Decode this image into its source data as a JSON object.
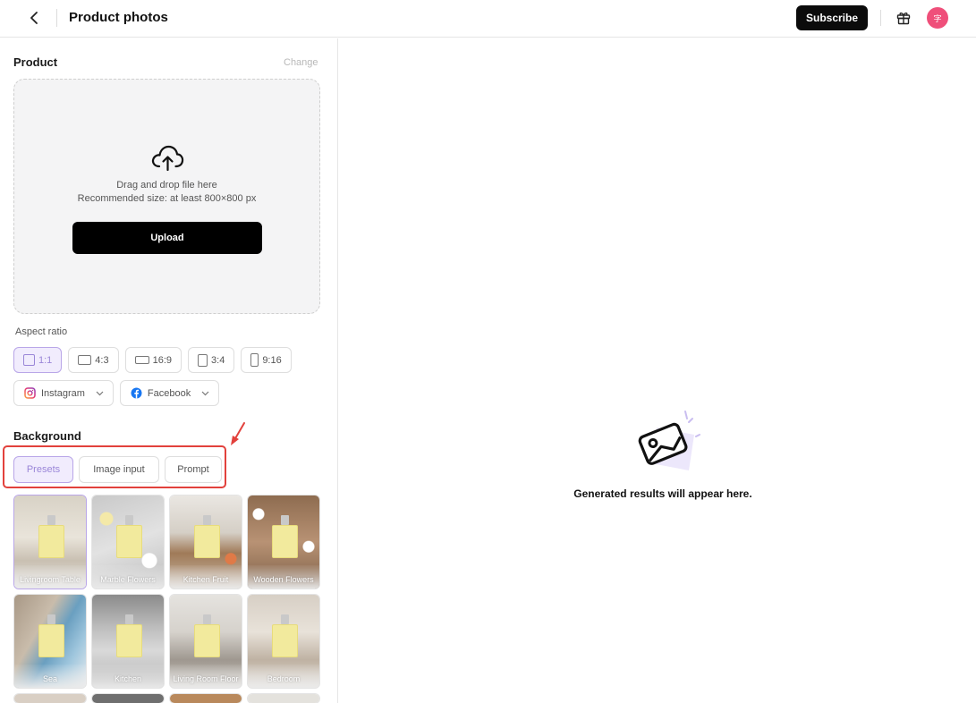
{
  "header": {
    "title": "Product photos",
    "subscribe_label": "Subscribe",
    "avatar_text": "字"
  },
  "product": {
    "title": "Product",
    "change_label": "Change",
    "drop_hint": "Drag and drop file here",
    "size_hint": "Recommended size: at least 800×800 px",
    "upload_label": "Upload"
  },
  "aspect": {
    "label": "Aspect ratio",
    "ratios": [
      {
        "label": "1:1",
        "active": true
      },
      {
        "label": "4:3",
        "active": false
      },
      {
        "label": "16:9",
        "active": false
      },
      {
        "label": "3:4",
        "active": false
      },
      {
        "label": "9:16",
        "active": false
      }
    ],
    "social": [
      {
        "label": "Instagram"
      },
      {
        "label": "Facebook"
      }
    ]
  },
  "background": {
    "title": "Background",
    "tabs": [
      {
        "label": "Presets",
        "active": true
      },
      {
        "label": "Image input",
        "active": false
      },
      {
        "label": "Prompt",
        "active": false
      }
    ],
    "presets": [
      {
        "label": "Livingroom Table",
        "selected": true
      },
      {
        "label": "Marble Flowers",
        "selected": false
      },
      {
        "label": "Kitchen Fruit",
        "selected": false
      },
      {
        "label": "Wooden Flowers",
        "selected": false
      },
      {
        "label": "Sea",
        "selected": false
      },
      {
        "label": "Kitchen",
        "selected": false
      },
      {
        "label": "Living Room Floor",
        "selected": false
      },
      {
        "label": "Bedroom",
        "selected": false
      }
    ]
  },
  "results": {
    "empty_text": "Generated results will appear here."
  },
  "colors": {
    "accent": "#9a86d8",
    "accent_bg": "#f1ecfd",
    "highlight": "#e2413c",
    "avatar": "#ef4f7a"
  }
}
